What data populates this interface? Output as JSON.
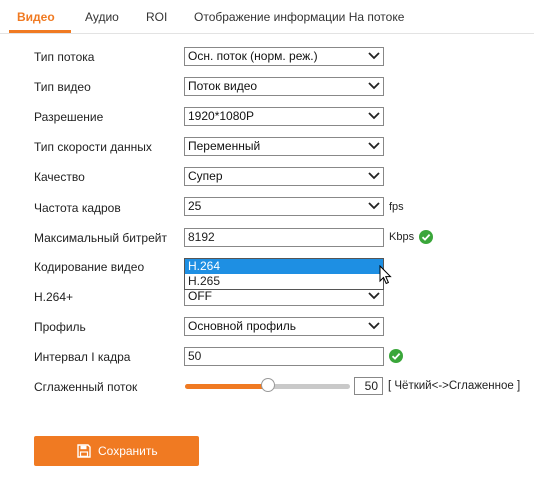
{
  "tabs": [
    {
      "label": "Видео",
      "active": true
    },
    {
      "label": "Аудио"
    },
    {
      "label": "ROI"
    },
    {
      "label": "Отображение информации На потоке"
    }
  ],
  "fields": {
    "stream_type": {
      "label": "Тип потока",
      "value": "Осн. поток (норм. реж.)"
    },
    "video_type": {
      "label": "Тип видео",
      "value": "Поток видео"
    },
    "resolution": {
      "label": "Разрешение",
      "value": "1920*1080P"
    },
    "bitrate_type": {
      "label": "Тип скорости данных",
      "value": "Переменный"
    },
    "quality": {
      "label": "Качество",
      "value": "Супер"
    },
    "frame_rate": {
      "label": "Частота кадров",
      "value": "25",
      "unit": "fps"
    },
    "max_bitrate": {
      "label": "Максимальный битрейт",
      "value": "8192",
      "unit": "Kbps"
    },
    "video_encoding": {
      "label": "Кодирование видео",
      "options": [
        "H.264",
        "H.265"
      ],
      "highlighted": "H.264"
    },
    "h264plus": {
      "label": "H.264+",
      "value": "OFF"
    },
    "profile": {
      "label": "Профиль",
      "value": "Основной профиль"
    },
    "iframe_interval": {
      "label": "Интервал I кадра",
      "value": "50"
    },
    "smoothing": {
      "label": "Сглаженный поток",
      "value": "50",
      "range_hint": "[ Чёткий<->Сглаженное ]",
      "level_percent": 50
    }
  },
  "save_label": "Сохранить",
  "colors": {
    "accent": "#f07a22",
    "ok": "#3aa63a",
    "highlight": "#1e8fe3"
  },
  "icons": {
    "dropdown": "chevron-down-icon",
    "ok": "check-circle-icon",
    "save": "floppy-disk-icon",
    "cursor": "mouse-pointer-icon"
  }
}
